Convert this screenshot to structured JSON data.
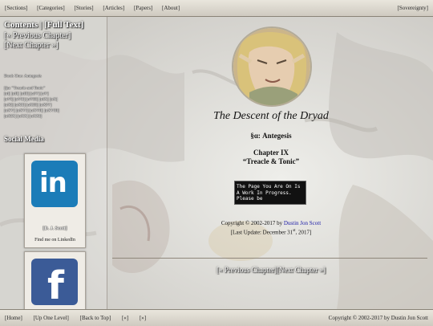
{
  "topbar": {
    "items": [
      "[Sections]",
      "[Categories]",
      "[Stories]",
      "[Articles]",
      "[Papers]",
      "[About]"
    ],
    "right": "[Sovereignty]"
  },
  "sidebar": {
    "contents_heading": "Contents | [Full Text]",
    "prev_link": "[« Previous Chapter]",
    "next_link": "[Next Chapter »]",
    "book_label": "Book One: Antegesis",
    "chapters": [
      "[§α: \"Treacle and Tonic\"",
      "[αI] [αII] [αIII] [αIV] [αV]",
      "[αVI] [αVII] [αVIII] [αIX] [αX]",
      "[αXI] [αXII] [αXIII] [αXIV]",
      "[αXV] [αXVI] [αXVII] [αXVIII]",
      "[αXIX] [αXX] [αXXI]"
    ],
    "social_heading": "Social Media",
    "cards": [
      {
        "name": "[D. J. Scott]",
        "caption": "Find me on LinkedIn",
        "icon": "linkedin-icon",
        "glyph": "in"
      },
      {
        "icon": "facebook-icon",
        "glyph": "f"
      }
    ]
  },
  "main": {
    "book_title": "The Descent of the Dryad",
    "part": "§α: Antegesis",
    "chapter_number": "Chapter IX",
    "chapter_title": "“Treacle & Tonic”",
    "wip_notice": "The Page You Are On Is A Work In Progress. Please be",
    "copyright_prefix": "Copyright © 2002-2017 by",
    "copyright_author": "Dustin Jon Scott",
    "last_update_prefix": "[Last Update: December 31",
    "last_update_sup": "st",
    "last_update_suffix": ", 2017]",
    "prev_chapter": "[« Previous Chapter]",
    "next_chapter": "[Next Chapter »]"
  },
  "bottombar": {
    "items": [
      "[Home]",
      "[Up One Level]",
      "[Back to Top]",
      "[«]",
      "[»]"
    ],
    "right": "Copyright © 2002-2017 by Dustin Jon Scott"
  },
  "colors": {
    "linkedin": "#1b7cb8",
    "facebook": "#3b5b97",
    "link": "#1a1aa6"
  }
}
